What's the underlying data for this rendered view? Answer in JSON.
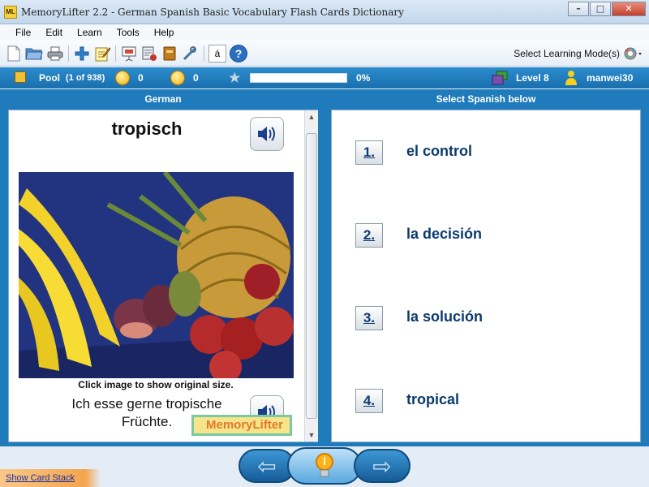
{
  "window": {
    "icon_text": "ML",
    "title": "MemoryLifter 2.2 - German Spanish Basic Vocabulary Flash Cards Dictionary",
    "minimize": "–",
    "maximize": "□",
    "close": "✕"
  },
  "menu": [
    "File",
    "Edit",
    "Learn",
    "Tools",
    "Help"
  ],
  "toolbar": {
    "icons": [
      "new-file-icon",
      "open-folder-icon",
      "print-icon",
      "add-card-icon",
      "edit-notepad-icon",
      "slideshow-icon",
      "card-settings-icon",
      "dictionary-icon",
      "tools-icon",
      "accent-char-icon",
      "help-icon"
    ],
    "accent_glyph": "á",
    "help_glyph": "?",
    "learning_mode_label": "Select Learning Mode(s)"
  },
  "status": {
    "pool_label": "Pool",
    "pool_count": "(1 of 938)",
    "correct_count": "0",
    "wrong_count": "0",
    "progress_percent": 0,
    "progress_text": "0%",
    "level_text": "Level 8",
    "username": "manwei30"
  },
  "question": {
    "header": "German",
    "word": "tropisch",
    "image_caption": "Click image to show original size.",
    "example_sentence": "Ich esse gerne tropische Früchte.",
    "logo_text": "MemoryLifter"
  },
  "answers": {
    "header": "Select Spanish below",
    "options": [
      {
        "number": "1.",
        "text": "el control"
      },
      {
        "number": "2.",
        "text": "la decisión"
      },
      {
        "number": "3.",
        "text": "la solución"
      },
      {
        "number": "4.",
        "text": "tropical"
      }
    ]
  },
  "bottom": {
    "show_card_stack": "Show Card Stack",
    "back_arrow": "⇦",
    "next_arrow": "⇨"
  },
  "colors": {
    "accent_blue": "#1f7bbb",
    "answer_text": "#0b3a6e",
    "progress_fill": "#7cc348"
  }
}
